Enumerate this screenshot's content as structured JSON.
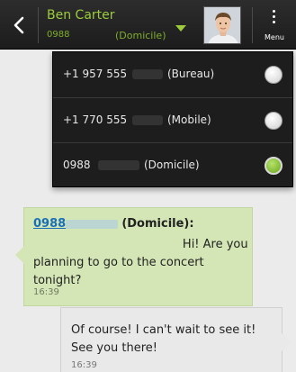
{
  "header": {
    "back_icon": "chevron-left-icon",
    "contact_name": "Ben Carter",
    "contact_number": "0988",
    "contact_label": "(Domicile)",
    "dropdown_icon": "triangle-down-icon",
    "menu_label": "Menu",
    "menu_icon": "vertical-dots-icon",
    "accent_color": "#9ccc3c"
  },
  "numbers": [
    {
      "number": "+1 957 555",
      "type": "(Bureau)",
      "selected": false
    },
    {
      "number": "+1 770 555",
      "type": "(Mobile)",
      "selected": false
    },
    {
      "number": "0988",
      "type": "(Domicile)",
      "selected": true
    }
  ],
  "messages": [
    {
      "direction": "incoming",
      "sender_number": "0988",
      "sender_label": "(Domicile):",
      "text": "Hi! Are you planning to go to the concert tonight?",
      "time": "16:39"
    },
    {
      "direction": "outgoing",
      "text": "Of course! I can't wait to see it! See you there!",
      "time": "16:39"
    }
  ]
}
